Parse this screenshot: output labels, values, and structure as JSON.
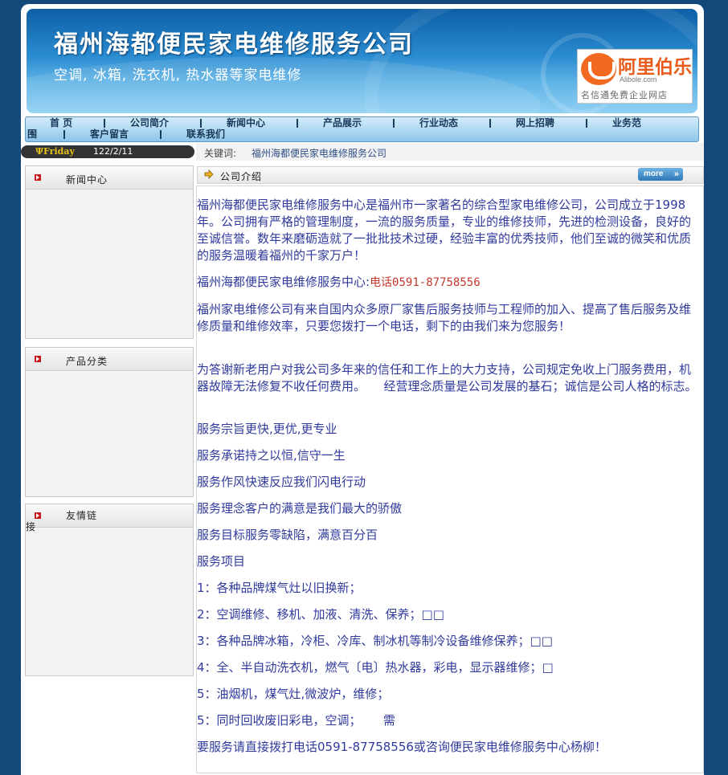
{
  "header": {
    "title": "福州海都便民家电维修服务公司",
    "subtitle": "空调, 冰箱, 洗衣机, 热水器等家电维修",
    "logo": {
      "name": "阿里伯乐",
      "url_text": "Alibole.com",
      "slogan": "名信通免费企业网店",
      "brand_color": "#f26a21"
    }
  },
  "nav": {
    "items": [
      "首 页",
      "公司简介",
      "新闻中心",
      "产品展示",
      "行业动态",
      "网上招聘",
      "业务范",
      "围",
      "客户留言",
      "联系我们"
    ]
  },
  "datebar": {
    "day": "Friday",
    "date": "122/2/11"
  },
  "keyword": {
    "label": "关键词:",
    "value": "福州海都便民家电维修服务公司"
  },
  "sidebar": {
    "panels": [
      {
        "title": "新闻中心"
      },
      {
        "title": "产品分类"
      },
      {
        "title_line1": "友情链",
        "title_line2": "接"
      }
    ]
  },
  "main": {
    "section_title": "公司介绍",
    "more_label": "more",
    "paragraphs": [
      "福州海都便民家电维修服务中心是福州市一家著名的综合型家电维修公司，公司成立于1998年。公司拥有严格的管理制度，一流的服务质量，专业的维修技师，先进的检测设备，良好的至诚信誉。数年来磨砺造就了一批批技术过硬，经验丰富的优秀技师，他们至诚的微笑和优质的服务温暖着福州的千家万户！",
      "福州家电维修公司有来自国内众多原厂家售后服务技师与工程师的加入、提高了售后服务及维修质量和维修效率，只要您拨打一个电话，剩下的由我们来为您服务！",
      "为答谢新老用户对我公司多年来的信任和工作上的大力支持，公司规定免收上门服务费用，机器故障无法修复不收任何费用。　　经营理念质量是公司发展的基石；诚信是公司人格的标志。",
      "服务宗旨更快,更优,更专业",
      "服务承诺持之以恒,信守一生",
      "服务作风快速反应我们闪电行动",
      "服务理念客户的满意是我们最大的骄傲",
      "服务目标服务零缺陷，满意百分百",
      "服务项目",
      "1：各种品牌煤气灶以旧换新；",
      "2：空调维修、移机、加液、清洗、保养；□□",
      "3：各种品牌冰箱，冷柜、冷库、制冰机等制冷设备维修保养；□□",
      "4：全、半自动洗衣机，燃气〔电〕热水器，彩电，显示器维修；□",
      "5：油烟机，煤气灶,微波炉，维修；",
      "5：同时回收废旧彩电，空调；　　 需",
      "要服务请直接拨打电话0591-87758556或咨询便民家电维修服务中心杨柳！"
    ],
    "phone_line": {
      "prefix": "福州海都便民家电维修服务中心:",
      "phone": "电话0591-87758556"
    }
  }
}
